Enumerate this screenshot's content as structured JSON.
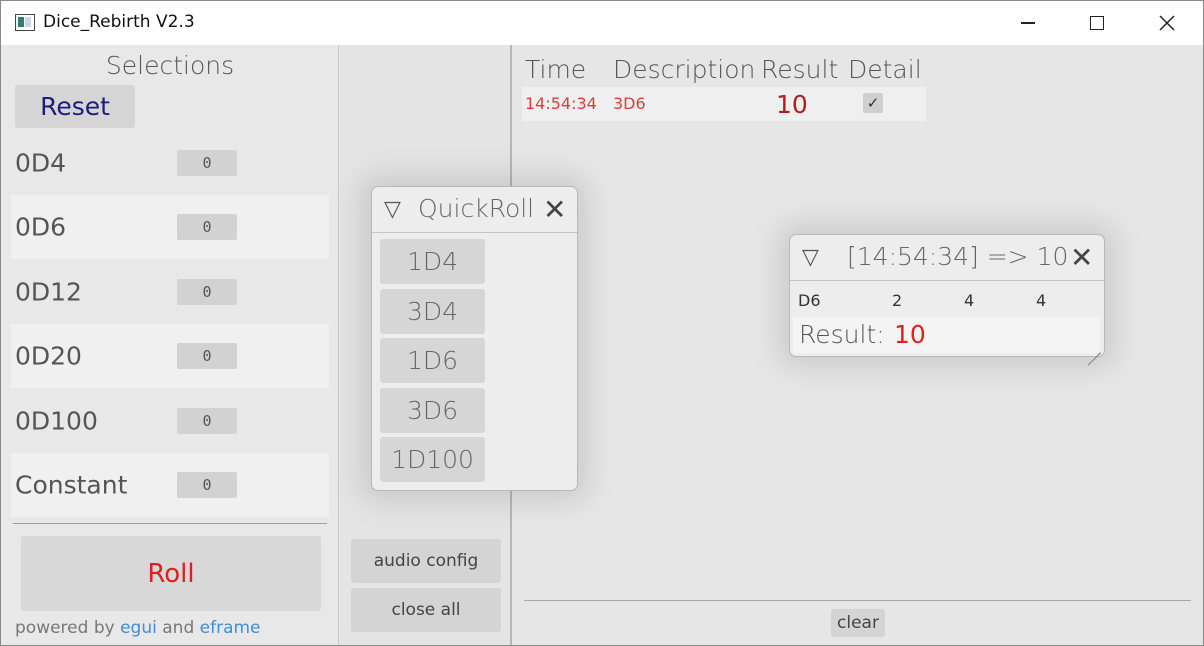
{
  "window": {
    "title": "Dice_Rebirth V2.3",
    "minimize_icon": "minimize-icon",
    "maximize_icon": "maximize-icon",
    "close_icon": "close-icon"
  },
  "left": {
    "title": "Selections",
    "reset_label": "Reset",
    "dice": [
      {
        "label": "0D4",
        "value": "0"
      },
      {
        "label": "0D6",
        "value": "0"
      },
      {
        "label": "0D12",
        "value": "0"
      },
      {
        "label": "0D20",
        "value": "0"
      },
      {
        "label": "0D100",
        "value": "0"
      },
      {
        "label": "Constant",
        "value": "0"
      }
    ],
    "roll_label": "Roll",
    "powered_prefix": "powered by ",
    "egui_link": "egui",
    "and_text": " and ",
    "eframe_link": "eframe"
  },
  "middle": {
    "audio_config_label": "audio config",
    "close_all_label": "close all"
  },
  "quickroll": {
    "title": "QuickRoll",
    "collapse_icon": "▽",
    "close_icon": "✕",
    "buttons": [
      "1D4",
      "3D4",
      "1D6",
      "3D6",
      "1D100"
    ]
  },
  "history": {
    "headers": {
      "time": "Time",
      "description": "Description",
      "result": "Result",
      "detail": "Detail"
    },
    "rows": [
      {
        "time": "14:54:34",
        "description": "3D6",
        "result": "10",
        "detail_checked": "✓"
      }
    ],
    "clear_label": "clear"
  },
  "detail_window": {
    "collapse_icon": "▽",
    "title": "[14:54:34]  => 10",
    "close_icon": "✕",
    "dice_type": "D6",
    "rolls": [
      "2",
      "4",
      "4"
    ],
    "result_label": "Result:",
    "result_value": "10"
  },
  "colors": {
    "accent_red": "#e02020",
    "link_blue": "#3d8ed8",
    "reset_text": "#1c1c80"
  }
}
